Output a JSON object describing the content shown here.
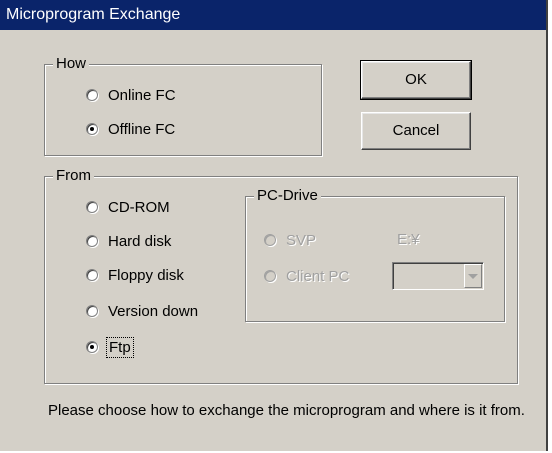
{
  "window": {
    "title": "Microprogram Exchange"
  },
  "how": {
    "label": "How",
    "options": [
      {
        "label": "Online FC",
        "selected": false
      },
      {
        "label": "Offline FC",
        "selected": true
      }
    ]
  },
  "from": {
    "label": "From",
    "options": [
      {
        "label": "CD-ROM",
        "selected": false
      },
      {
        "label": "Hard disk",
        "selected": false
      },
      {
        "label": "Floppy disk",
        "selected": false
      },
      {
        "label": "Version down",
        "selected": false
      },
      {
        "label": "Ftp",
        "selected": true
      }
    ]
  },
  "pc_drive": {
    "label": "PC-Drive",
    "svp_label": "SVP",
    "svp_value": "E:¥",
    "client_pc_label": "Client PC",
    "drive_select_value": ""
  },
  "buttons": {
    "ok": "OK",
    "cancel": "Cancel"
  },
  "message": "Please choose how to exchange the microprogram and where is it from."
}
